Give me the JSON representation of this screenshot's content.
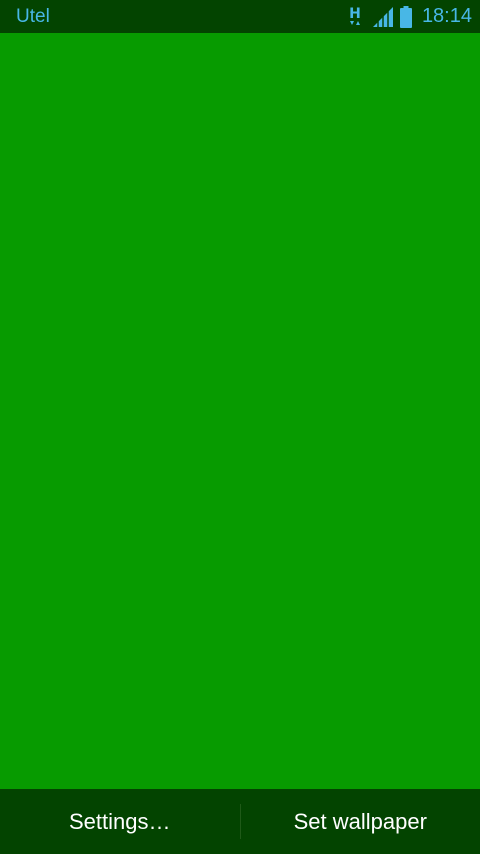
{
  "status_bar": {
    "carrier": "Utel",
    "network_type_icon": "hspa-data-icon",
    "signal_icon": "signal-strength-icon",
    "battery_icon": "battery-icon",
    "time": "18:14",
    "text_color": "#48b7e6",
    "background": "#034400"
  },
  "preview": {
    "background": "#079b00"
  },
  "bottom_bar": {
    "settings_label": "Settings…",
    "set_wallpaper_label": "Set wallpaper",
    "background": "#034400"
  }
}
